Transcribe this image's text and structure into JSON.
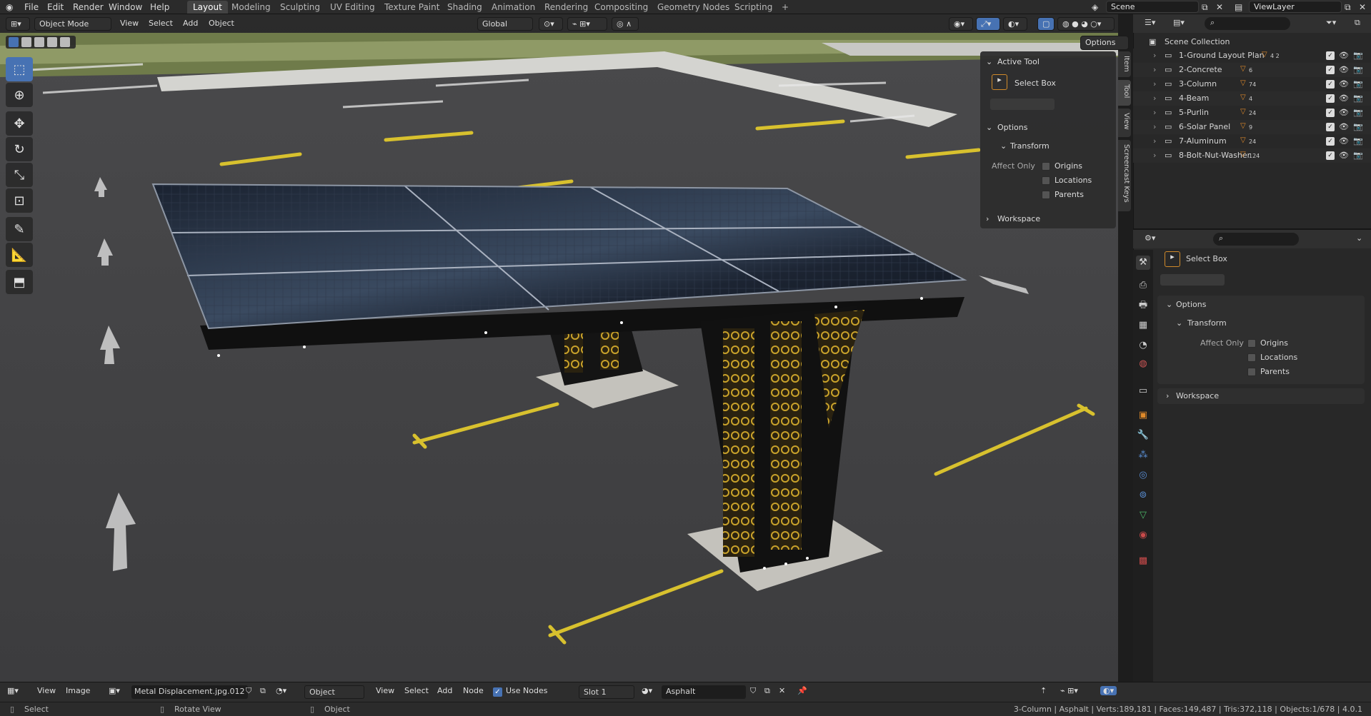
{
  "topbar": {
    "menus": [
      "File",
      "Edit",
      "Render",
      "Window",
      "Help"
    ],
    "workspaces": [
      "Layout",
      "Modeling",
      "Sculpting",
      "UV Editing",
      "Texture Paint",
      "Shading",
      "Animation",
      "Rendering",
      "Compositing",
      "Geometry Nodes",
      "Scripting"
    ],
    "active_workspace": "Layout",
    "add_tab": "+",
    "scene_label": "Scene",
    "viewlayer_label": "ViewLayer"
  },
  "viewport_header": {
    "mode": "Object Mode",
    "menus": [
      "View",
      "Select",
      "Add",
      "Object"
    ],
    "transform_orientation": "Global",
    "options_button": "Options"
  },
  "npanel": {
    "tabs": [
      "Item",
      "Tool",
      "View",
      "Screencast Keys"
    ],
    "active_tool_title": "Active Tool",
    "tool_name": "Select Box",
    "options_title": "Options",
    "transform_title": "Transform",
    "affect_only": "Affect Only",
    "checkboxes": [
      "Origins",
      "Locations",
      "Parents"
    ],
    "workspace_title": "Workspace"
  },
  "outliner": {
    "root": "Scene Collection",
    "collections": [
      {
        "name": "1-Ground Layout Plan",
        "badge": "4 2"
      },
      {
        "name": "2-Concrete",
        "badge": "6"
      },
      {
        "name": "3-Column",
        "badge": "74"
      },
      {
        "name": "4-Beam",
        "badge": "4"
      },
      {
        "name": "5-Purlin",
        "badge": "24"
      },
      {
        "name": "6-Solar Panel",
        "badge": "9"
      },
      {
        "name": "7-Aluminum",
        "badge": "24"
      },
      {
        "name": "8-Bolt-Nut-Washer",
        "badge": "124"
      }
    ]
  },
  "properties": {
    "tool_name": "Select Box",
    "options_title": "Options",
    "transform_title": "Transform",
    "affect_only": "Affect Only",
    "checkboxes": [
      "Origins",
      "Locations",
      "Parents"
    ],
    "workspace_title": "Workspace"
  },
  "node_bar": {
    "menus": [
      "View",
      "Image"
    ],
    "image_name": "Metal Displacement.jpg.012",
    "object_label": "Object",
    "menus2": [
      "View",
      "Select",
      "Add",
      "Node"
    ],
    "use_nodes": "Use Nodes",
    "slot": "Slot 1",
    "material": "Asphalt"
  },
  "statusbar": {
    "left": [
      "Select",
      "Rotate View",
      "Object"
    ],
    "stats": "3-Column | Asphalt | Verts:189,181 | Faces:149,487 | Tris:372,118 | Objects:1/678 | 4.0.1"
  },
  "colors": {
    "accent": "#4772b3",
    "panel": "#282828",
    "header": "#2b2b2b",
    "asphalt": "#3a3a3c",
    "lane_yellow": "#d8c12e",
    "gold": "#c9a22a"
  }
}
